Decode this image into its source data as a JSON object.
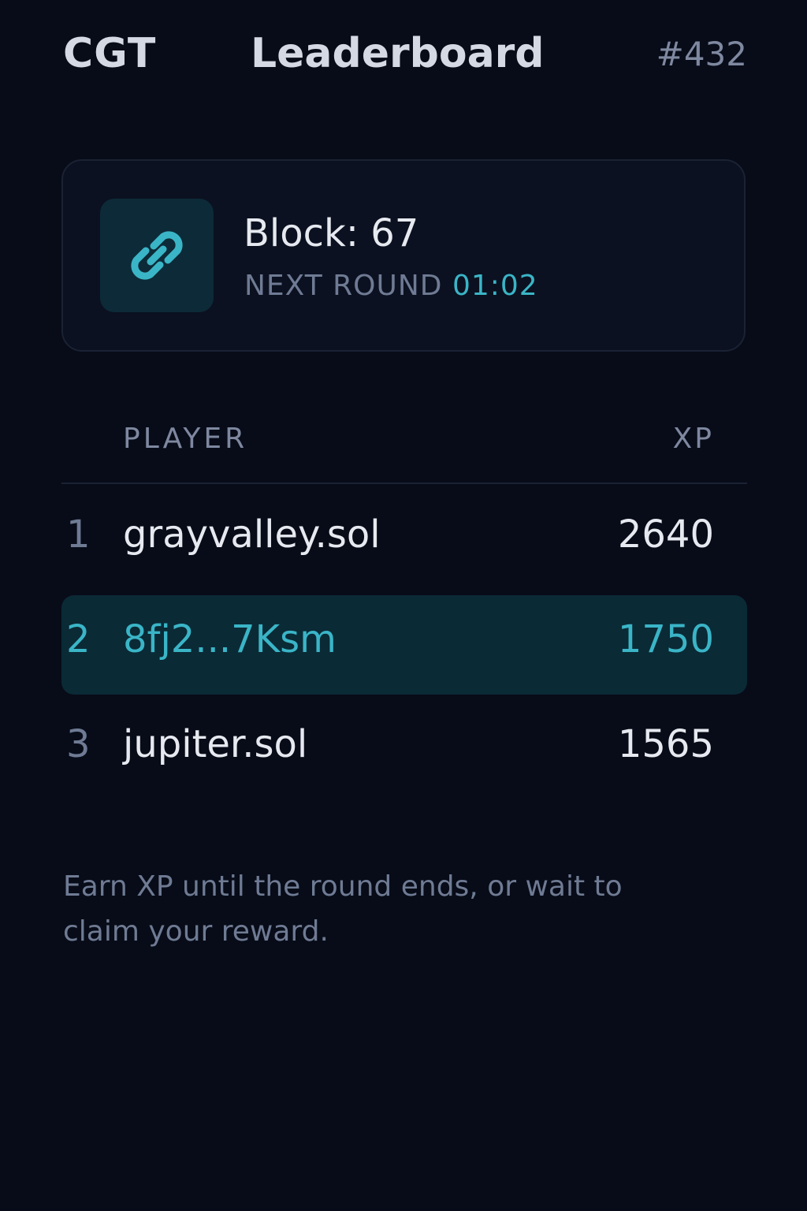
{
  "header": {
    "brand": "CGT",
    "title": "Leaderboard",
    "round_id": "#432"
  },
  "block_card": {
    "icon": "link-icon",
    "title": "Block: 67",
    "next_round_label": "NEXT ROUND",
    "next_round_timer": "01:02"
  },
  "table": {
    "columns": {
      "player": "PLAYER",
      "xp": "XP"
    },
    "rows": [
      {
        "rank": "1",
        "name": "grayvalley.sol",
        "xp": "2640",
        "highlighted": false
      },
      {
        "rank": "2",
        "name": "8fj2...7Ksm",
        "xp": "1750",
        "highlighted": true
      },
      {
        "rank": "3",
        "name": "jupiter.sol",
        "xp": "1565",
        "highlighted": false
      }
    ]
  },
  "footer": {
    "note": "Earn XP until the round ends, or wait to claim your reward."
  },
  "colors": {
    "background": "#080c18",
    "accent": "#3ab5c7",
    "highlight_row": "#0a2a36",
    "muted_text": "#6f7b94"
  }
}
